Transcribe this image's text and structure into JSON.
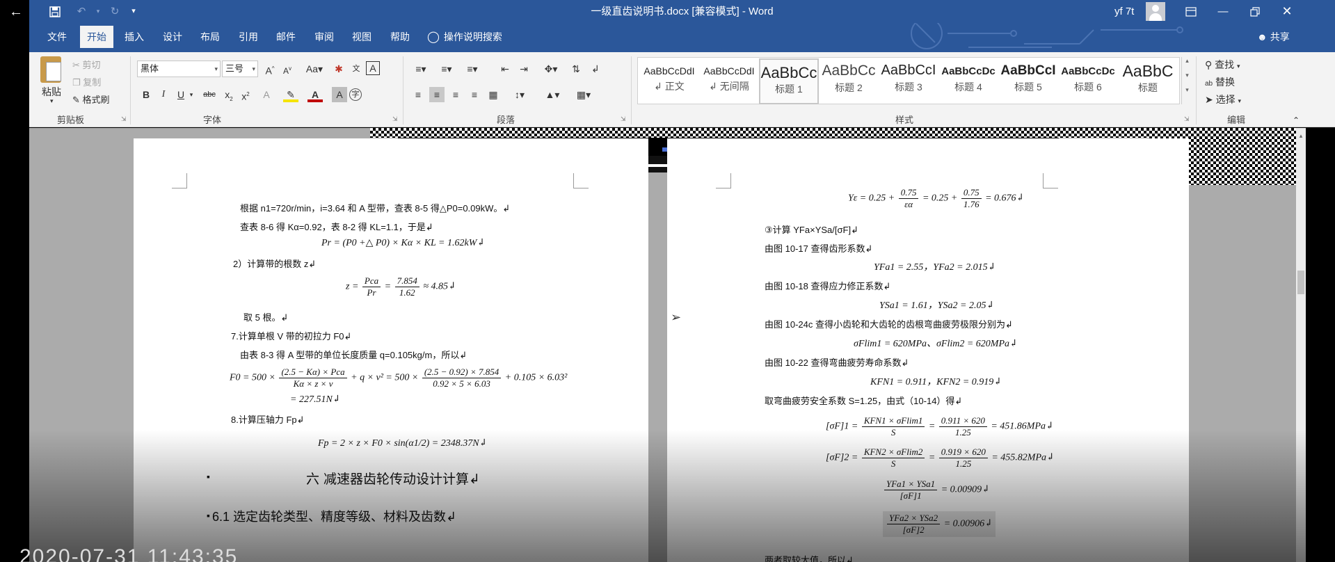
{
  "window": {
    "title": "一级直齿说明书.docx [兼容模式]  -  Word",
    "user": "yf 7t",
    "back_icon": "arrow-left-icon"
  },
  "quick_access": {
    "save": "save-icon",
    "undo": "undo-icon",
    "redo": "redo-icon",
    "customize": "customize-icon"
  },
  "tabs": [
    "文件",
    "开始",
    "插入",
    "设计",
    "布局",
    "引用",
    "邮件",
    "审阅",
    "视图",
    "帮助"
  ],
  "active_tab": "开始",
  "tell_me": "操作说明搜索",
  "share": "共享",
  "ribbon": {
    "clipboard": {
      "label": "剪贴板",
      "paste": "粘贴",
      "cut": "剪切",
      "copy": "复制",
      "format_painter": "格式刷"
    },
    "font": {
      "label": "字体",
      "font_name": "黑体",
      "font_size": "三号"
    },
    "paragraph": {
      "label": "段落"
    },
    "styles": {
      "label": "样式",
      "items": [
        {
          "sample": "AaBbCcDdI",
          "name": "↲ 正文"
        },
        {
          "sample": "AaBbCcDdI",
          "name": "↲ 无间隔"
        },
        {
          "sample": "AaBbCc",
          "name": "标题 1"
        },
        {
          "sample": "AaBbCc",
          "name": "标题 2"
        },
        {
          "sample": "AaBbCcI",
          "name": "标题 3"
        },
        {
          "sample": "AaBbCcDc",
          "name": "标题 4"
        },
        {
          "sample": "AaBbCcI",
          "name": "标题 5"
        },
        {
          "sample": "AaBbCcDc",
          "name": "标题 6"
        },
        {
          "sample": "AaBbC",
          "name": "标题"
        }
      ]
    },
    "editing": {
      "label": "编辑",
      "find": "查找",
      "replace": "替换",
      "select": "选择"
    }
  },
  "left_page": [
    "根据 n1=720r/min，i=3.64 和 A 型带，查表 8-5 得△P0=0.09kW。↲",
    "查表 8-6 得 Kα=0.92，表 8-2 得 KL=1.1，于是↲",
    "Pr = (P0 +△ P0) × Kα × KL = 1.62kW↲",
    "2）计算带的根数 z↲",
    "z =",
    "Pca",
    "Pr",
    "=",
    "7.854",
    "1.62",
    "≈ 4.85↲",
    "取 5 根。↲",
    "7.计算单根 V 带的初拉力 F0↲",
    "由表 8-3 得 A 型带的单位长度质量 q=0.105kg/m，所以↲",
    "F0 = 500 ×",
    "(2.5 − Kα) × Pca",
    "Kα × z × v",
    "+ q × v² = 500 ×",
    "(2.5 − 0.92) × 7.854",
    "0.92 × 5 × 6.03",
    "+ 0.105 × 6.03²",
    "= 227.51N↲",
    "8.计算压轴力 Fp↲",
    "Fp = 2 × z × F0 × sin(α1/2) = 2348.37N↲",
    "六  减速器齿轮传动设计计算↲",
    "6.1 选定齿轮类型、精度等级、材料及齿数↲"
  ],
  "right_page": [
    "Yε = 0.25 +",
    "0.75",
    "εα",
    "= 0.25 +",
    "0.75",
    "1.76",
    "= 0.676↲",
    "③计算 YFa×YSa/[σF]↲",
    "由图 10-17 查得齿形系数↲",
    "YFa1 = 2.55，YFa2 = 2.015↲",
    "由图 10-18 查得应力修正系数↲",
    "YSa1 = 1.61，YSa2 = 2.05↲",
    "由图 10-24c 查得小齿轮和大齿轮的齿根弯曲疲劳极限分别为↲",
    "σFlim1 = 620MPa、σFlim2 = 620MPa↲",
    "由图 10-22 查得弯曲疲劳寿命系数↲",
    "KFN1 = 0.911，KFN2 = 0.919↲",
    "取弯曲疲劳安全系数 S=1.25，由式（10-14）得↲",
    "[σF]1 =",
    "KFN1 × σFlim1",
    "S",
    "=",
    "0.911 × 620",
    "1.25",
    "= 451.86MPa↲",
    "[σF]2 =",
    "KFN2 × σFlim2",
    "S",
    "=",
    "0.919 × 620",
    "1.25",
    "= 455.82MPa↲",
    "YFa1 × YSa1",
    "[σF]1",
    "= 0.00909↲",
    "YFa2 × YSa2",
    "[σF]2",
    "= 0.00906↲",
    "两者取较大值，所以↲"
  ],
  "overlay_timestamp": "2020-07-31 11:43:35"
}
